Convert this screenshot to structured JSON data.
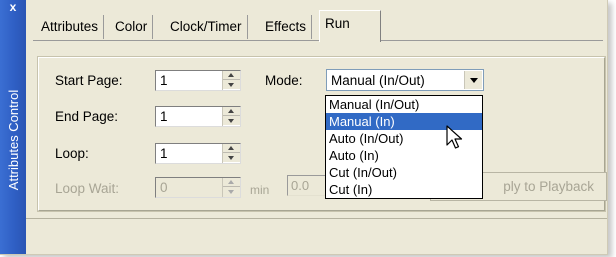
{
  "window": {
    "close_glyph": "x",
    "sidebar_label": "Attributes Control"
  },
  "tabs": [
    {
      "label": "Attributes",
      "active": false
    },
    {
      "label": "Color",
      "active": false
    },
    {
      "label": "Clock/Timer",
      "active": false
    },
    {
      "label": "Effects",
      "active": false
    },
    {
      "label": "Run",
      "active": true
    }
  ],
  "fields": {
    "start_page": {
      "label": "Start Page:",
      "value": "1"
    },
    "end_page": {
      "label": "End Page:",
      "value": "1"
    },
    "loop": {
      "label": "Loop:",
      "value": "1"
    },
    "loop_wait": {
      "label": "Loop Wait:",
      "value": "0",
      "unit": "min",
      "seconds_value": "0.0",
      "disabled": true
    }
  },
  "mode": {
    "label": "Mode:",
    "selected": "Manual (In/Out)",
    "options": [
      "Manual (In/Out)",
      "Manual (In)",
      "Auto (In/Out)",
      "Auto (In)",
      "Cut (In/Out)",
      "Cut (In)"
    ],
    "highlighted_option": "Manual (In)"
  },
  "buttons": {
    "apply_label": "ply to Playback",
    "apply_disabled": true
  },
  "colors": {
    "sidebar": "#2f5fc4",
    "panel_bg": "#ece9d8",
    "highlight": "#316ac5",
    "disabled_text": "#a8a595"
  },
  "icons": {
    "cursor": "arrow-pointer-icon",
    "close": "close-icon"
  }
}
